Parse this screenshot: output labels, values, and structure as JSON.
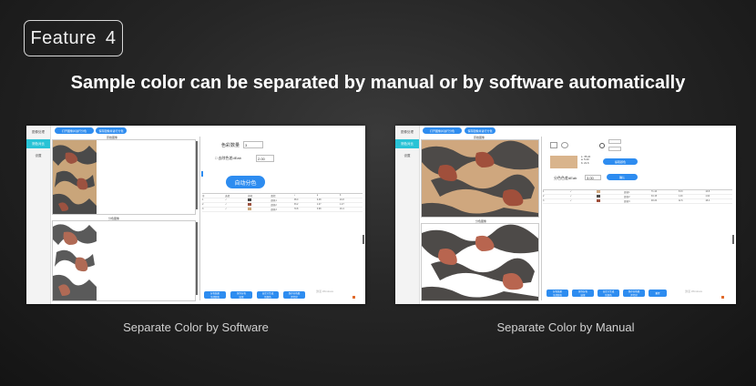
{
  "feature": {
    "label": "Feature",
    "number": "4"
  },
  "headline": "Sample color can be separated by manual or by software automatically",
  "left_panel": {
    "caption": "Separate Color by Software",
    "sidebar": [
      "图像处理",
      "测色对比",
      "设置"
    ],
    "top_buttons": [
      "打开图像并进行分色",
      "保存图像并进行分色"
    ],
    "original_title": "原始图像",
    "result_title": "分色图像",
    "color_count_label": "色彩数量",
    "color_count_value": "3",
    "remove_color_label": "去除色差dEab",
    "remove_color_value": "2.00",
    "auto_button": "自动分色",
    "table_headers": [
      "序",
      "选择",
      "颜色",
      "面积",
      "L",
      "a",
      "b"
    ],
    "table_rows": [
      [
        "1",
        "✓",
        "",
        "颜色1",
        "38.0",
        "6.48",
        "16.8"
      ],
      [
        "2",
        "✓",
        "",
        "颜色2",
        "33.2",
        "1.27",
        "1.27"
      ],
      [
        "3",
        "✓",
        "",
        "颜色3",
        "70.8",
        "3.98",
        "16.4"
      ]
    ],
    "bottom_buttons": [
      "分色结果\n全部颜色",
      "保存分色\n结果",
      "自定义生成\n新颜色",
      "保存分色图\n并打印"
    ],
    "watermark": "激活 Windows"
  },
  "right_panel": {
    "caption": "Separate Color by Manual",
    "sidebar": [
      "图像处理",
      "测色对比",
      "设置"
    ],
    "top_buttons": [
      "打开图像并进行分色",
      "保存图像并进行分色"
    ],
    "original_title": "原始图像",
    "result_title": "分色图像",
    "lab_values": [
      "L: 78.24",
      "a: 5.20",
      "b: 21.6"
    ],
    "pick_button": "提取颜色",
    "tolerance_label": "分色色差dEab",
    "tolerance_value": "3.00",
    "confirm_button": "确认",
    "table_rows": [
      [
        "1",
        "✓",
        "颜色1",
        "71.44",
        "8.03",
        "13.8"
      ],
      [
        "2",
        "✓",
        "颜色2",
        "33.15",
        "0.40",
        "1.64"
      ],
      [
        "3",
        "✓",
        "颜色3",
        "48.20",
        "22.6",
        "18.4"
      ]
    ],
    "bottom_buttons": [
      "分色结果\n全部颜色",
      "保存分色\n结果",
      "自定义生成\n新颜色",
      "保存分色图\n并打印",
      "重置"
    ],
    "watermark": "激活 Windows"
  }
}
